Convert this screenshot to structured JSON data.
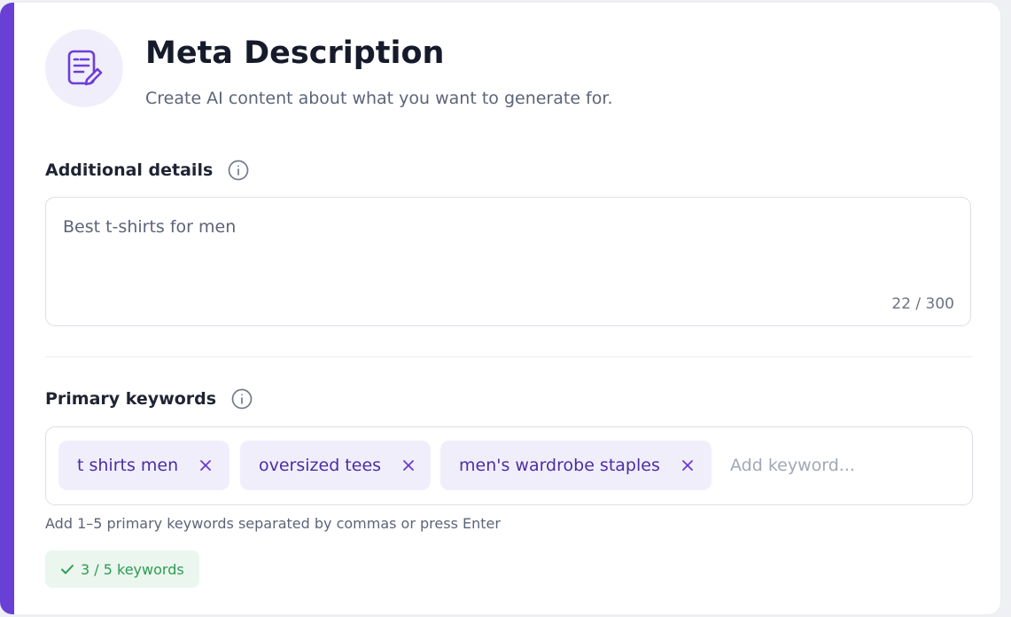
{
  "header": {
    "title": "Meta Description",
    "subtitle": "Create AI content about what you want to generate for.",
    "icon": "document-edit-icon"
  },
  "colors": {
    "accent": "#6a3fd6",
    "chip_bg": "#f1eefc",
    "chip_text": "#4a2ea3",
    "success": "#2e9a54",
    "success_bg": "#eaf6ee"
  },
  "additional_details": {
    "label": "Additional details",
    "info_icon": "info-icon",
    "value": "Best t-shirts for men",
    "counter": "22 / 300"
  },
  "primary_keywords": {
    "label": "Primary keywords",
    "info_icon": "info-icon",
    "chips": [
      {
        "label": "t shirts men"
      },
      {
        "label": "oversized tees"
      },
      {
        "label": "men's wardrobe staples"
      }
    ],
    "input_placeholder": "Add keyword...",
    "helper": "Add 1–5 primary keywords separated by commas or press Enter",
    "status": "3 / 5 keywords"
  }
}
